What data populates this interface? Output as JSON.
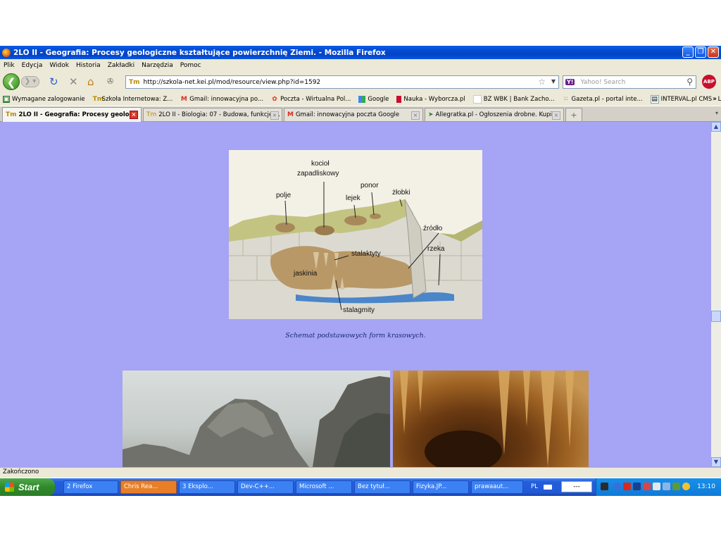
{
  "window": {
    "title": "2LO II - Geografia: Procesy geologiczne kształtujące powierzchnię Ziemi. - Mozilla Firefox"
  },
  "menu": [
    "Plik",
    "Edycja",
    "Widok",
    "Historia",
    "Zakładki",
    "Narzędzia",
    "Pomoc"
  ],
  "nav": {
    "url": "http://szkola-net.kei.pl/mod/resource/view.php?id=1592",
    "search_placeholder": "Yahoo! Search",
    "abp_label": "ABP"
  },
  "bookmarks": [
    "Wymagane zalogowanie",
    "Szkoła Internetowa: Z...",
    "Gmail: innowacyjna po...",
    "Poczta - Wirtualna Pol...",
    "Google",
    "Nauka - Wyborcza.pl",
    "BZ WBK | Bank Zacho...",
    "Gazeta.pl - portal inte...",
    "INTERVAL.pl CMS - Lo..."
  ],
  "tabs": [
    "2LO II - Geografia: Procesy geolo...",
    "2LO II - Biologia: 07 - Budowa, funkcje,...",
    "Gmail: innowacyjna poczta Google",
    "Allegratka.pl - Ogłoszenia drobne. Kupi..."
  ],
  "diagram_labels": {
    "kociol": "kocioł",
    "zapadliskowy": "zapadliskowy",
    "polje": "polje",
    "lejek": "lejek",
    "ponor": "ponor",
    "zlobki": "żłobki",
    "zrodlo": "źródło",
    "rzeka": "rzeka",
    "stalaktyty": "stalaktyty",
    "jaskinia": "jaskinia",
    "stalagmity": "stalagmity"
  },
  "caption": "Schemat podstawowych form krasowych.",
  "status": "Zakończono",
  "taskbar": {
    "start": "Start",
    "tasks": [
      "2 Firefox",
      "Chris Rea...",
      "3 Eksplo...",
      "Dev-C++...",
      "Microsoft ...",
      "Bez tytuł...",
      "Fizyka.JP...",
      "prawaaut..."
    ],
    "lang": "PL",
    "tray_field": "---",
    "clock": "13:10"
  }
}
